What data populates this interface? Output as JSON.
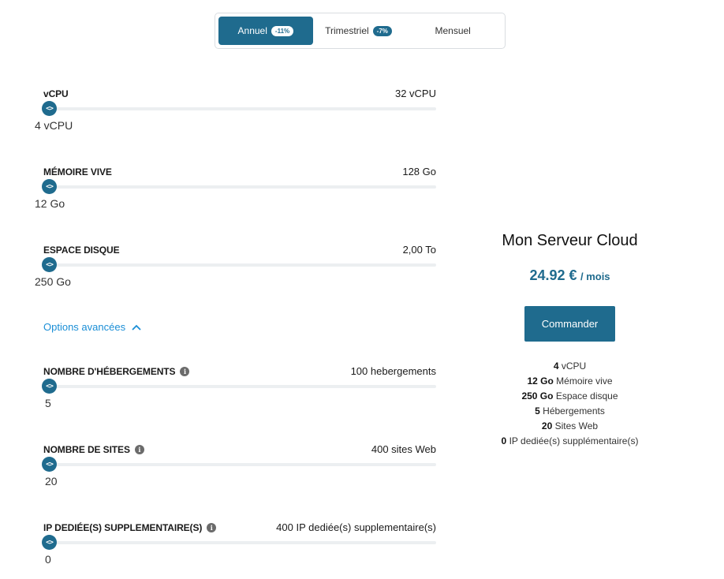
{
  "billing": {
    "tabs": [
      {
        "label": "Annuel",
        "badge": "-11%"
      },
      {
        "label": "Trimestriel",
        "badge": "-7%"
      },
      {
        "label": "Mensuel"
      }
    ]
  },
  "config": {
    "rows": [
      {
        "label": "vCPU",
        "max": "32 vCPU",
        "value": "4 vCPU",
        "level": 0
      },
      {
        "label": "MÉMOIRE VIVE",
        "max": "128 Go",
        "value": "12 Go",
        "level": 0
      },
      {
        "label": "ESPACE DISQUE",
        "max": "2,00 To",
        "value": "250 Go",
        "level": 0
      }
    ],
    "advanced_label": "Options avancées",
    "advanced_rows": [
      {
        "label": "NOMBRE D'HÉBERGEMENTS",
        "max": "100 hebergements",
        "value": "5",
        "level": 0
      },
      {
        "label": "NOMBRE DE SITES",
        "max": "400 sites Web",
        "value": "20",
        "level": 0
      },
      {
        "label": "IP DEDIÉE(S) SUPPLEMENTAIRE(S)",
        "max": "400 IP dediée(s) supplementaire(s)",
        "value": "0",
        "level": 0
      }
    ],
    "handle_glyph": "<>",
    "info_glyph": "i"
  },
  "summary": {
    "title": "Mon Serveur Cloud",
    "price": "24.92 €",
    "price_unit": "/ mois",
    "order_label": "Commander",
    "specs": [
      {
        "value": "4",
        "label": "vCPU"
      },
      {
        "value": "12 Go",
        "label": "Mémoire vive"
      },
      {
        "value": "250 Go",
        "label": "Espace disque"
      },
      {
        "value": "5",
        "label": "Hébergements"
      },
      {
        "value": "20",
        "label": "Sites Web"
      },
      {
        "value": "0",
        "label": "IP dediée(s) supplémentaire(s)"
      }
    ]
  },
  "colors": {
    "accent": "#1f6b8e",
    "link": "#1a8ed6",
    "track": "#eceff1"
  }
}
